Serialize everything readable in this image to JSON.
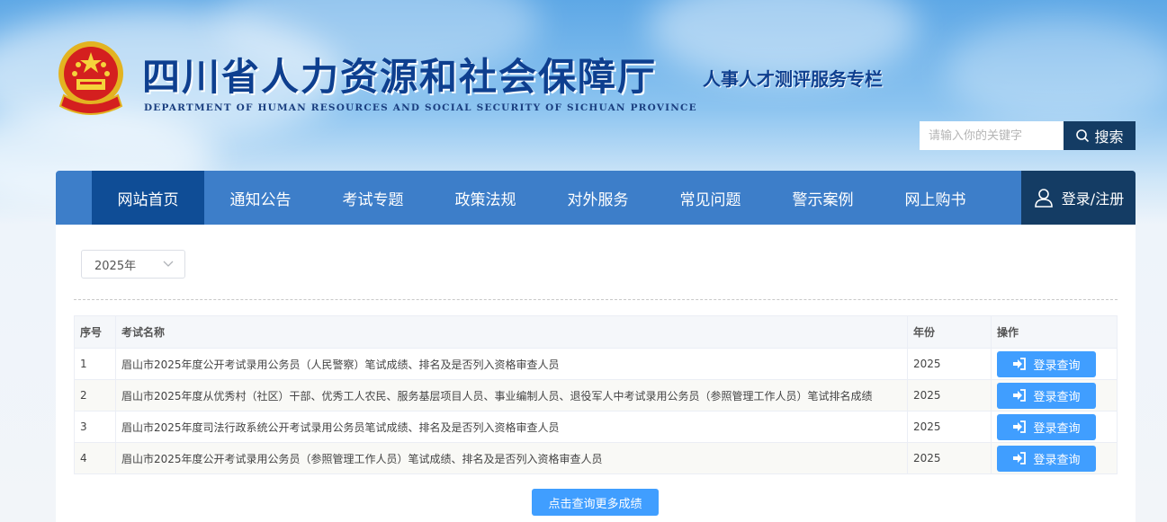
{
  "header": {
    "title_cn": "四川省人力资源和社会保障厅",
    "title_en": "DEPARTMENT OF HUMAN RESOURCES AND SOCIAL SECURITY OF SICHUAN PROVINCE",
    "subtitle": "人事人才测评服务专栏"
  },
  "search": {
    "placeholder": "请输入你的关键字",
    "button_label": "搜索"
  },
  "nav": {
    "items": [
      {
        "label": "网站首页",
        "active": true
      },
      {
        "label": "通知公告"
      },
      {
        "label": "考试专题"
      },
      {
        "label": "政策法规"
      },
      {
        "label": "对外服务"
      },
      {
        "label": "常见问题"
      },
      {
        "label": "警示案例"
      },
      {
        "label": "网上购书"
      }
    ],
    "login_label": "登录/注册"
  },
  "filter": {
    "year_value": "2025年"
  },
  "table": {
    "headers": [
      "序号",
      "考试名称",
      "年份",
      "操作"
    ],
    "rows": [
      {
        "no": "1",
        "name": "眉山市2025年度公开考试录用公务员（人民警察）笔试成绩、排名及是否列入资格审查人员",
        "year": "2025",
        "action": "登录查询"
      },
      {
        "no": "2",
        "name": "眉山市2025年度从优秀村（社区）干部、优秀工人农民、服务基层项目人员、事业编制人员、退役军人中考试录用公务员（参照管理工作人员）笔试排名成绩",
        "year": "2025",
        "action": "登录查询"
      },
      {
        "no": "3",
        "name": "眉山市2025年度司法行政系统公开考试录用公务员笔试成绩、排名及是否列入资格审查人员",
        "year": "2025",
        "action": "登录查询"
      },
      {
        "no": "4",
        "name": "眉山市2025年度公开考试录用公务员（参照管理工作人员）笔试成绩、排名及是否列入资格审查人员",
        "year": "2025",
        "action": "登录查询"
      }
    ]
  },
  "more_button_label": "点击查询更多成绩",
  "colors": {
    "nav_bg": "#3d7ec9",
    "nav_active": "#0f4d96",
    "dark": "#143c64",
    "button": "#409eff",
    "title": "#0e3f8f"
  }
}
